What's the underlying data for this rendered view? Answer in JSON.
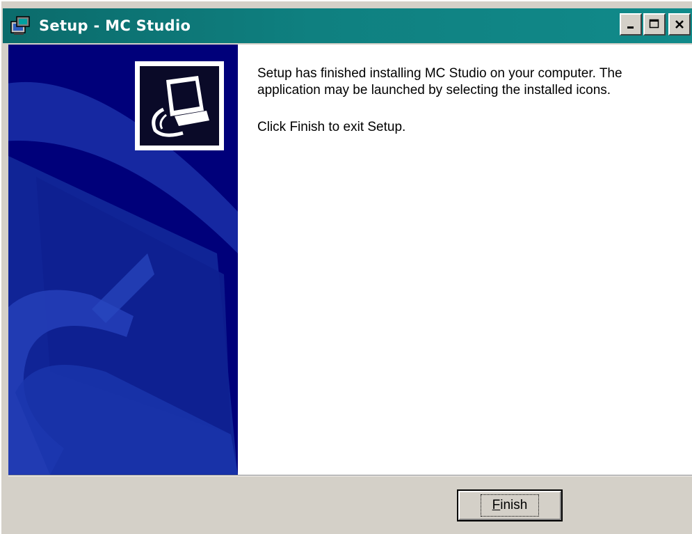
{
  "window": {
    "title": "Setup - MC Studio",
    "buttons": {
      "minimize": "_",
      "maximize": "□",
      "close": "×"
    }
  },
  "content": {
    "message_line1": "Setup has finished installing MC Studio on your computer. The",
    "message_line2": "application may be launched by selecting the installed icons.",
    "message_exit": "Click Finish to exit Setup."
  },
  "footer": {
    "finish_mnemonic": "F",
    "finish_rest": "inish"
  },
  "colors": {
    "titlebar": "#0f8080",
    "banner": "#00007a",
    "dialog_face": "#d4d0c8"
  }
}
